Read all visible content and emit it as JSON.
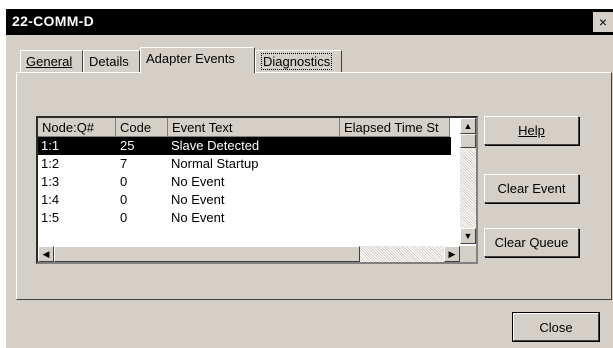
{
  "window": {
    "title": "22-COMM-D",
    "close_glyph": "×"
  },
  "tabs": [
    {
      "label": "General",
      "active": false
    },
    {
      "label": "Details",
      "active": false
    },
    {
      "label": "Adapter Events",
      "active": true
    },
    {
      "label": "Diagnostics",
      "active": false
    }
  ],
  "table": {
    "columns": [
      "Node:Q#",
      "Code",
      "Event Text",
      "Elapsed Time St"
    ],
    "rows": [
      {
        "node": "1:1",
        "code": "25",
        "text": "Slave Detected",
        "selected": true
      },
      {
        "node": "1:2",
        "code": "7",
        "text": "Normal Startup",
        "selected": false
      },
      {
        "node": "1:3",
        "code": "0",
        "text": "No Event",
        "selected": false
      },
      {
        "node": "1:4",
        "code": "0",
        "text": "No Event",
        "selected": false
      },
      {
        "node": "1:5",
        "code": "0",
        "text": "No Event",
        "selected": false
      }
    ]
  },
  "buttons": {
    "help": "Help",
    "clear_event": "Clear Event",
    "clear_queue": "Clear Queue",
    "close": "Close"
  },
  "icons": {
    "scroll_up": "▲",
    "scroll_down": "▼",
    "scroll_left": "◀",
    "scroll_right": "▶"
  }
}
